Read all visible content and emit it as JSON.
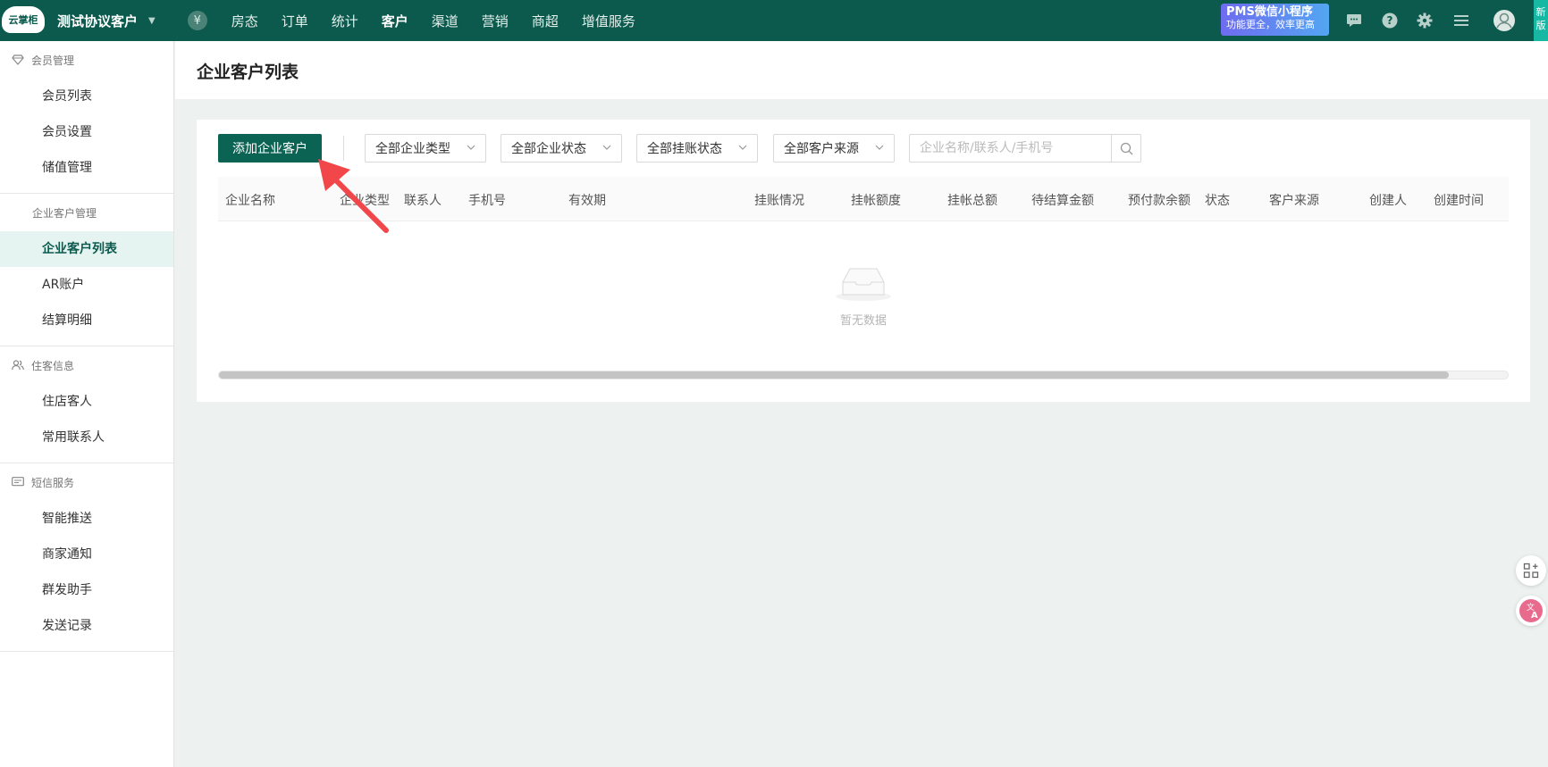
{
  "app": {
    "logo_text": "云掌柜",
    "store_name": "测试协议客户",
    "currency_symbol": "¥"
  },
  "topnav": {
    "items": [
      "房态",
      "订单",
      "统计",
      "客户",
      "渠道",
      "营销",
      "商超",
      "增值服务"
    ],
    "active": "客户"
  },
  "promo": {
    "line1": "PMS微信小程序",
    "line2": "功能更全，效率更高"
  },
  "newtag": {
    "line1": "新",
    "line2": "版"
  },
  "sidebar": {
    "groups": [
      {
        "title": "会员管理",
        "icon": "diamond-icon",
        "items": [
          "会员列表",
          "会员设置",
          "储值管理"
        ]
      },
      {
        "title": "企业客户管理",
        "icon": "",
        "items": [
          "企业客户列表",
          "AR账户",
          "结算明细"
        ]
      },
      {
        "title": "住客信息",
        "icon": "users-icon",
        "items": [
          "住店客人",
          "常用联系人"
        ]
      },
      {
        "title": "短信服务",
        "icon": "message-icon",
        "items": [
          "智能推送",
          "商家通知",
          "群发助手",
          "发送记录"
        ]
      }
    ],
    "active_item": "企业客户列表"
  },
  "page": {
    "title": "企业客户列表",
    "add_button": "添加企业客户",
    "filters": [
      "全部企业类型",
      "全部企业状态",
      "全部挂账状态",
      "全部客户来源"
    ],
    "search_placeholder": "企业名称/联系人/手机号"
  },
  "table": {
    "columns": [
      "企业名称",
      "企业类型",
      "联系人",
      "手机号",
      "有效期",
      "挂账情况",
      "挂帐额度",
      "挂帐总额",
      "待结算金额",
      "预付款余额",
      "状态",
      "客户来源",
      "创建人",
      "创建时间"
    ],
    "rows": [],
    "empty_text": "暂无数据",
    "scroll_fraction": 0.954
  },
  "colors": {
    "topbar": "#0b5a4d",
    "accent": "#0b6354",
    "annotation_arrow": "#f2474a"
  }
}
